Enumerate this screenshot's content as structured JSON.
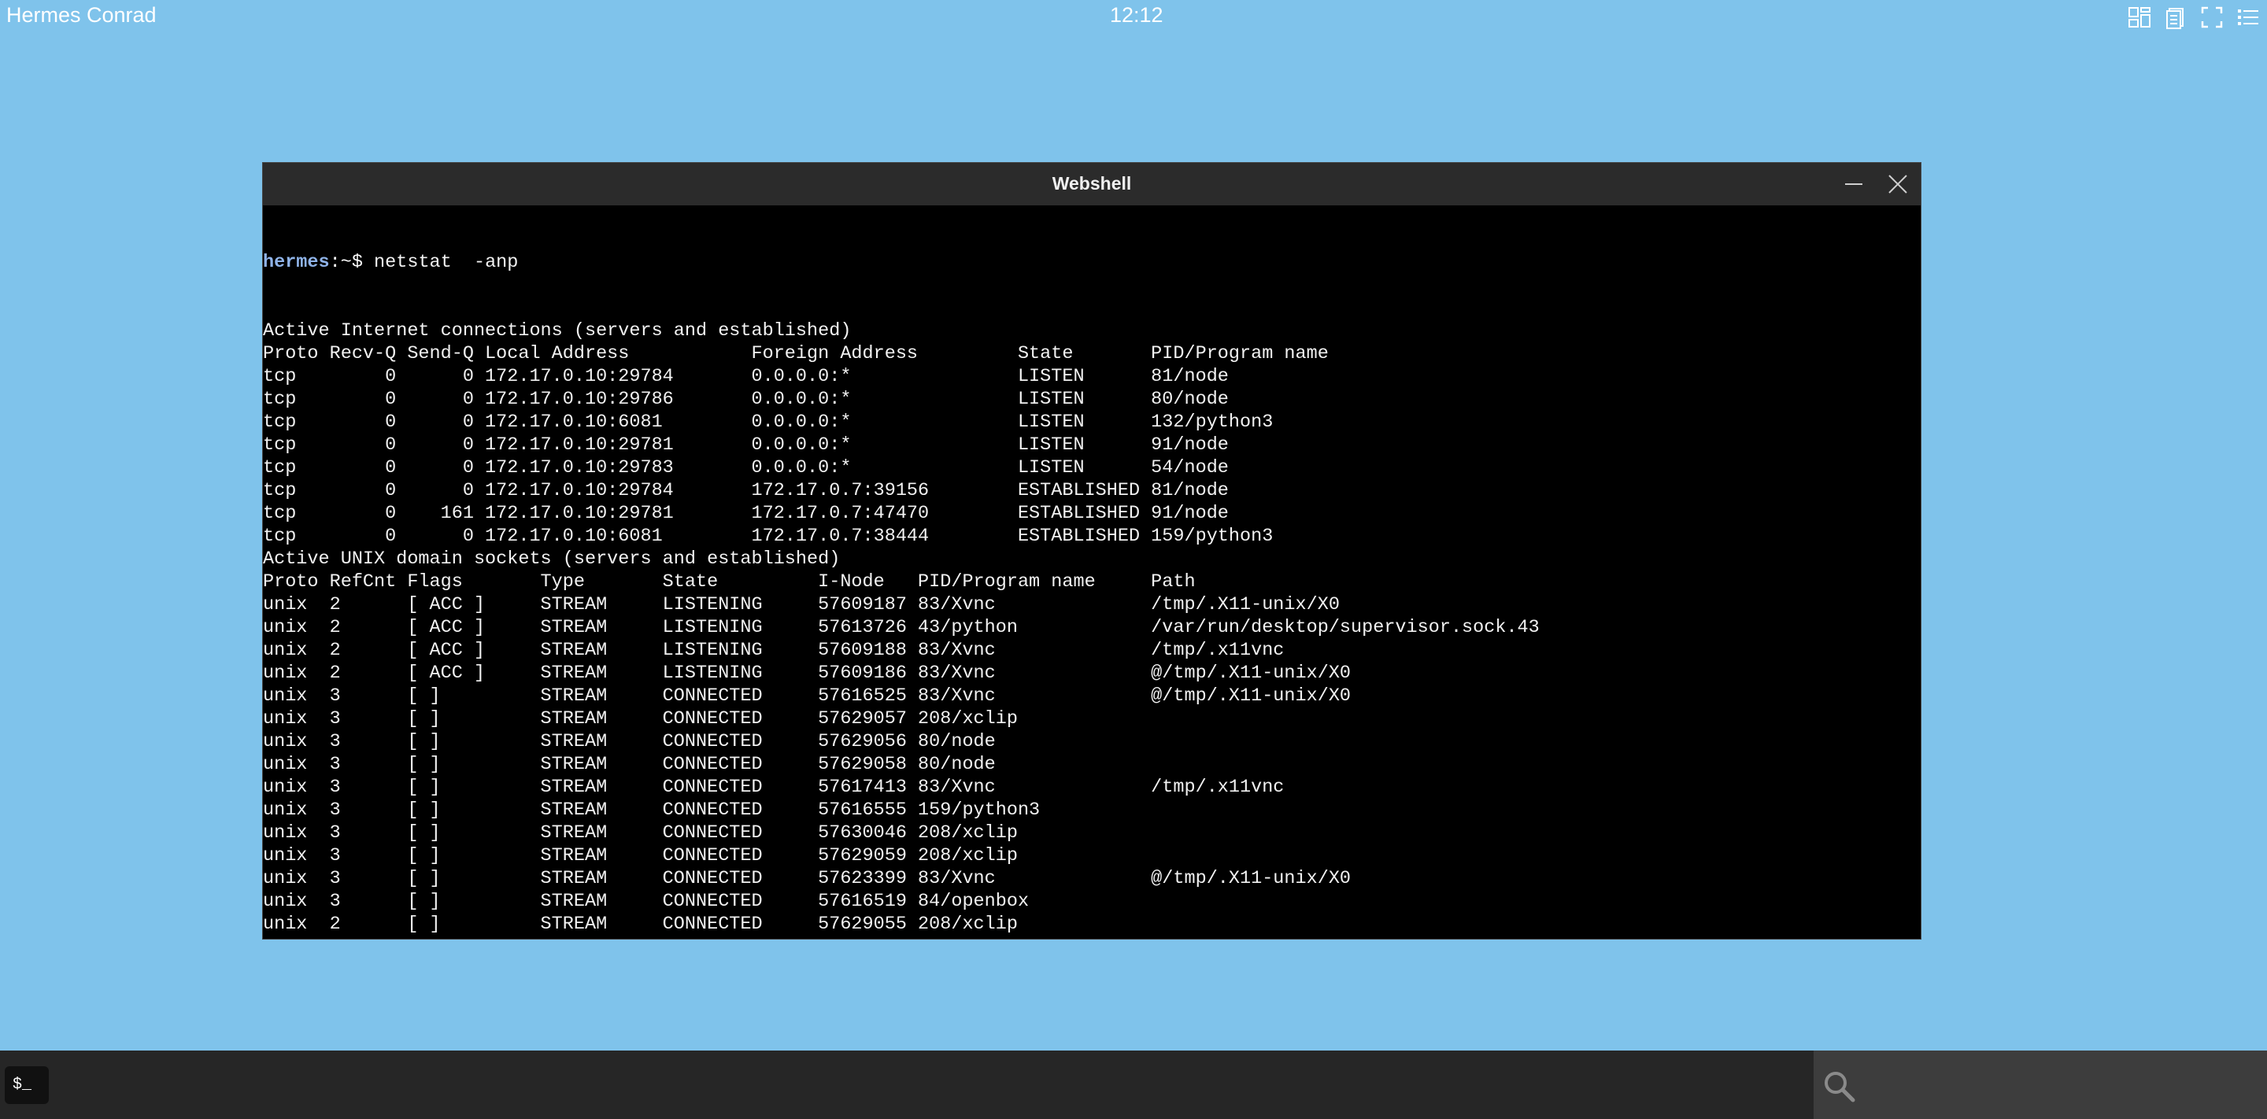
{
  "topbar": {
    "user": "Hermes Conrad",
    "clock": "12:12",
    "icons": [
      "layout-grid-icon",
      "document-icon",
      "fullscreen-icon",
      "list-menu-icon"
    ]
  },
  "window": {
    "title": "Webshell"
  },
  "terminal": {
    "prompt_user": "hermes",
    "prompt_path": ":~$",
    "command": " netstat  -anp",
    "lines": [
      "Active Internet connections (servers and established)",
      "Proto Recv-Q Send-Q Local Address           Foreign Address         State       PID/Program name",
      "tcp        0      0 172.17.0.10:29784       0.0.0.0:*               LISTEN      81/node",
      "tcp        0      0 172.17.0.10:29786       0.0.0.0:*               LISTEN      80/node",
      "tcp        0      0 172.17.0.10:6081        0.0.0.0:*               LISTEN      132/python3",
      "tcp        0      0 172.17.0.10:29781       0.0.0.0:*               LISTEN      91/node",
      "tcp        0      0 172.17.0.10:29783       0.0.0.0:*               LISTEN      54/node",
      "tcp        0      0 172.17.0.10:29784       172.17.0.7:39156        ESTABLISHED 81/node",
      "tcp        0    161 172.17.0.10:29781       172.17.0.7:47470        ESTABLISHED 91/node",
      "tcp        0      0 172.17.0.10:6081        172.17.0.7:38444        ESTABLISHED 159/python3",
      "Active UNIX domain sockets (servers and established)",
      "Proto RefCnt Flags       Type       State         I-Node   PID/Program name     Path",
      "unix  2      [ ACC ]     STREAM     LISTENING     57609187 83/Xvnc              /tmp/.X11-unix/X0",
      "unix  2      [ ACC ]     STREAM     LISTENING     57613726 43/python            /var/run/desktop/supervisor.sock.43",
      "unix  2      [ ACC ]     STREAM     LISTENING     57609188 83/Xvnc              /tmp/.x11vnc",
      "unix  2      [ ACC ]     STREAM     LISTENING     57609186 83/Xvnc              @/tmp/.X11-unix/X0",
      "unix  3      [ ]         STREAM     CONNECTED     57616525 83/Xvnc              @/tmp/.X11-unix/X0",
      "unix  3      [ ]         STREAM     CONNECTED     57629057 208/xclip",
      "unix  3      [ ]         STREAM     CONNECTED     57629056 80/node",
      "unix  3      [ ]         STREAM     CONNECTED     57629058 80/node",
      "unix  3      [ ]         STREAM     CONNECTED     57617413 83/Xvnc              /tmp/.x11vnc",
      "unix  3      [ ]         STREAM     CONNECTED     57616555 159/python3",
      "unix  3      [ ]         STREAM     CONNECTED     57630046 208/xclip",
      "unix  3      [ ]         STREAM     CONNECTED     57629059 208/xclip",
      "unix  3      [ ]         STREAM     CONNECTED     57623399 83/Xvnc              @/tmp/.X11-unix/X0",
      "unix  3      [ ]         STREAM     CONNECTED     57616519 84/openbox",
      "unix  2      [ ]         STREAM     CONNECTED     57629055 208/xclip"
    ]
  },
  "taskbar": {
    "terminal_label": "$_",
    "search_icon": "search-icon"
  }
}
